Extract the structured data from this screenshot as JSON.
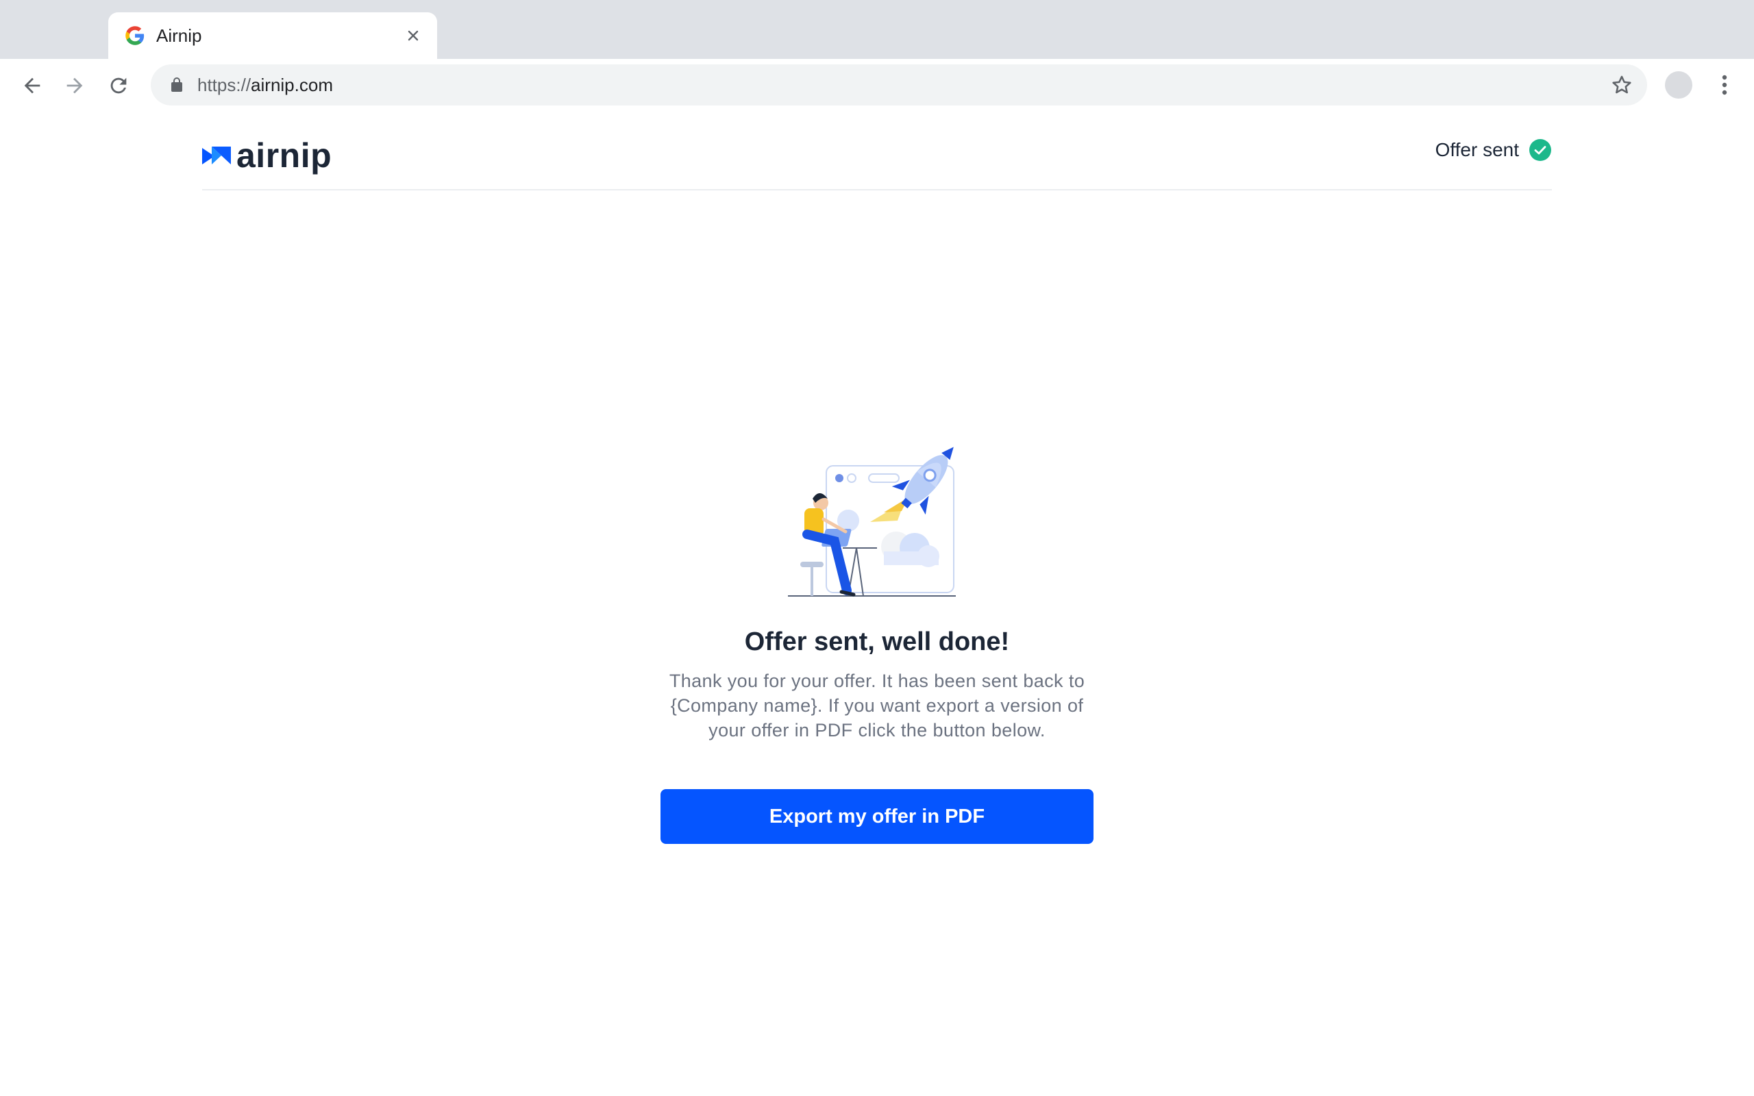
{
  "browser": {
    "tab_title": "Airnip",
    "url_scheme": "https://",
    "url_host": "airnip.com"
  },
  "header": {
    "logo_text": "airnip",
    "status_label": "Offer sent"
  },
  "main": {
    "headline": "Offer sent, well done!",
    "message": "Thank you for your offer. It has been sent back to {Company name}. If you want export a version of your offer in PDF click the button below.",
    "export_button_label": "Export my offer in PDF"
  },
  "colors": {
    "primary": "#0555ff",
    "success": "#1db88b",
    "text_dark": "#1c2636",
    "text_muted": "#6b7280"
  },
  "icons": [
    "google-favicon",
    "close-icon",
    "back-arrow-icon",
    "forward-arrow-icon",
    "reload-icon",
    "lock-icon",
    "star-icon",
    "profile-avatar",
    "more-vert-icon",
    "check-circle-icon"
  ]
}
